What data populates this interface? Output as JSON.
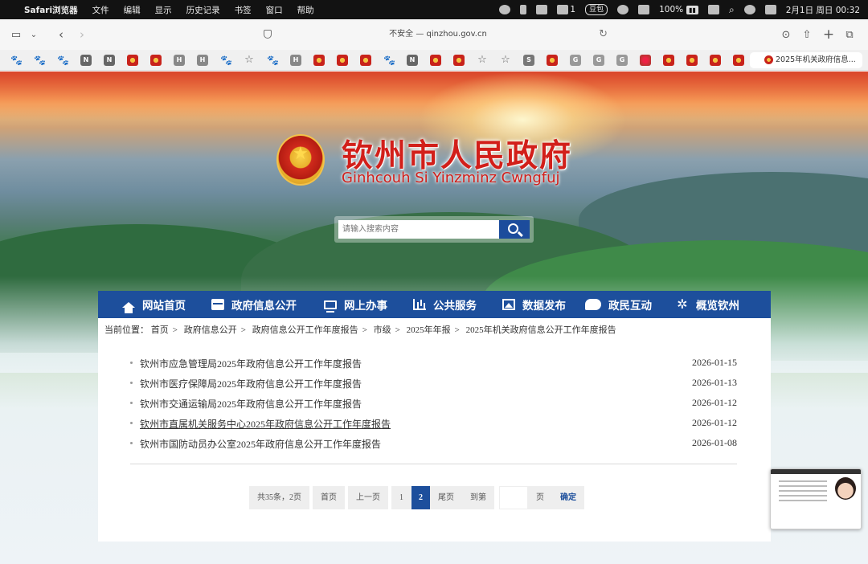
{
  "menubar": {
    "app": "Safari浏览器",
    "items": [
      "文件",
      "编辑",
      "显示",
      "历史记录",
      "书签",
      "窗口",
      "帮助"
    ],
    "status": {
      "doubao": "豆包",
      "shirt_count": "1",
      "battery": "100%",
      "datetime": "2月1日 周日 00:32"
    }
  },
  "toolbar": {
    "url": "不安全 — qinzhou.gov.cn"
  },
  "favorites": {
    "icons": [
      "paw",
      "paw",
      "paw",
      "N",
      "N",
      "emblem",
      "emblem",
      "H",
      "H",
      "paw",
      "star",
      "paw",
      "H",
      "emblem",
      "emblem",
      "emblem",
      "paw",
      "N",
      "emblem",
      "emblem",
      "star",
      "star",
      "S",
      "emblem",
      "G",
      "G",
      "G",
      "globe",
      "emblem",
      "emblem",
      "emblem",
      "emblem"
    ],
    "active_tab": "2025年机关政府信息..."
  },
  "site": {
    "title": "钦州市人民政府",
    "subtitle": "Ginhcouh Si Yinzminz Cwngfuj",
    "search_placeholder": "请输入搜索内容"
  },
  "nav": [
    {
      "label": "网站首页",
      "icon": "home-icon"
    },
    {
      "label": "政府信息公开",
      "icon": "box-icon"
    },
    {
      "label": "网上办事",
      "icon": "monitor-icon"
    },
    {
      "label": "公共服务",
      "icon": "chart-icon"
    },
    {
      "label": "数据发布",
      "icon": "photo-icon"
    },
    {
      "label": "政民互动",
      "icon": "chat-icon"
    },
    {
      "label": "概览钦州",
      "icon": "pin-icon"
    }
  ],
  "breadcrumb": {
    "prefix": "当前位置：",
    "items": [
      "首页",
      "政府信息公开",
      "政府信息公开工作年度报告",
      "市级",
      "2025年年报",
      "2025年机关政府信息公开工作年度报告"
    ],
    "separator": ">"
  },
  "list": [
    {
      "title": "钦州市应急管理局2025年政府信息公开工作年度报告",
      "date": "2026-01-15"
    },
    {
      "title": "钦州市医疗保障局2025年政府信息公开工作年度报告",
      "date": "2026-01-13"
    },
    {
      "title": "钦州市交通运输局2025年政府信息公开工作年度报告",
      "date": "2026-01-12"
    },
    {
      "title": "钦州市直属机关服务中心2025年政府信息公开工作年度报告",
      "date": "2026-01-12"
    },
    {
      "title": "钦州市国防动员办公室2025年政府信息公开工作年度报告",
      "date": "2026-01-08"
    }
  ],
  "pager": {
    "summary": "共35条，2页",
    "first": "首页",
    "prev": "上一页",
    "page1": "1",
    "page2": "2",
    "last": "尾页",
    "goto": "到第",
    "goto_value": "",
    "page_unit": "页",
    "confirm": "确定",
    "current_page": 2
  }
}
